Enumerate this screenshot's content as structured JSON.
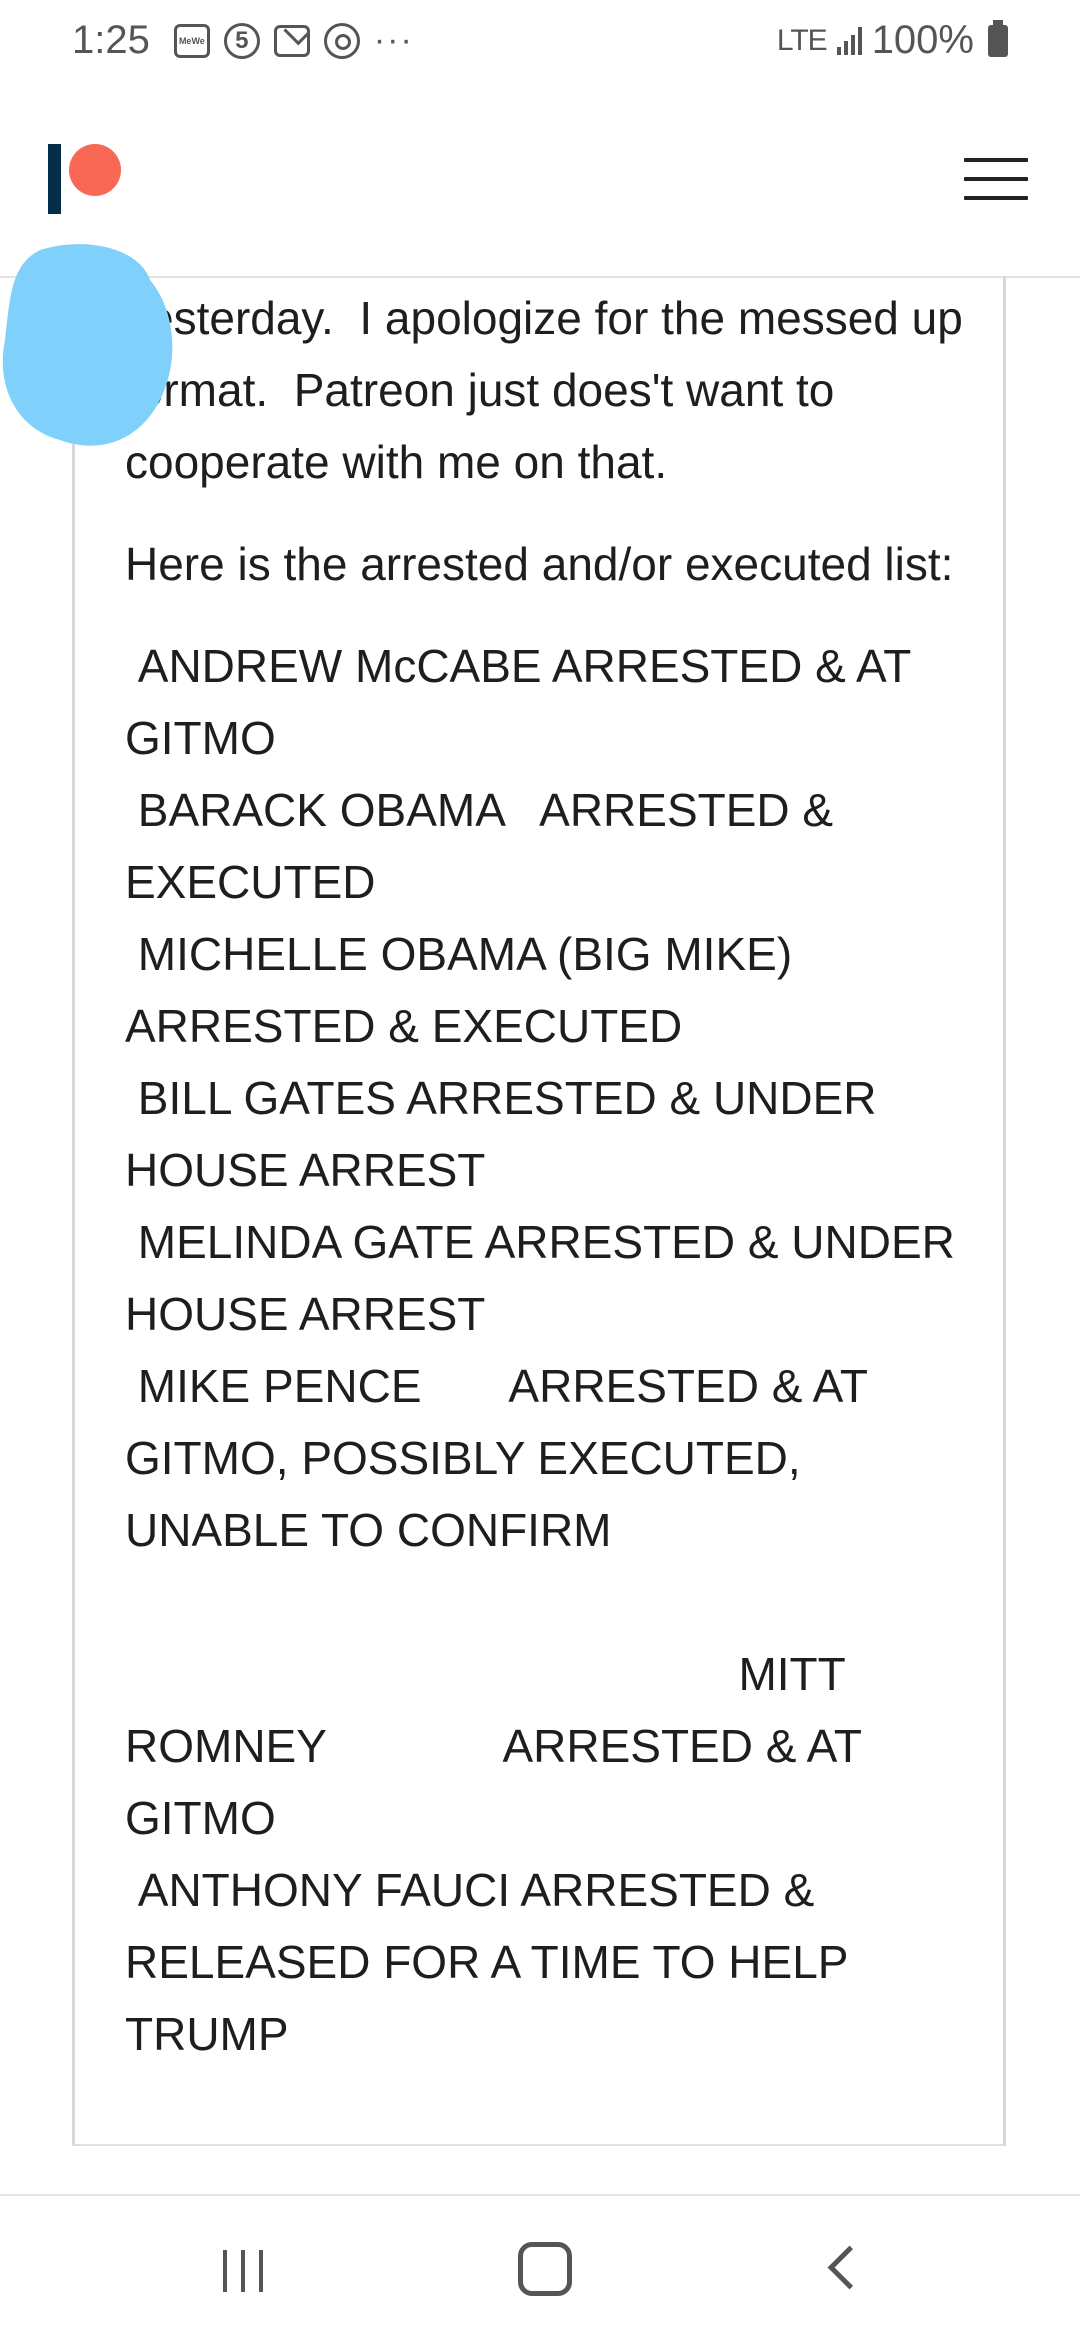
{
  "status_bar": {
    "time": "1:25",
    "notification_icons": [
      "mewe-icon",
      "five-icon",
      "mail-icon",
      "swirl-icon"
    ],
    "more_dots": "···",
    "network": "LTE",
    "battery": "100%"
  },
  "header": {
    "logo_colors": {
      "bar": "#052d49",
      "circle": "#f96854"
    }
  },
  "post": {
    "intro_text": "yesterday.  I apologize for the messed up format.  Patreon just does't want to cooperate with me on that.",
    "list_heading": "Here is the arrested and/or executed list:",
    "list_text": " ANDREW McCABE ARRESTED & AT GITMO\n BARACK OBAMA   ARRESTED & EXECUTED\n MICHELLE OBAMA (BIG MIKE) ARRESTED & EXECUTED\n BILL GATES ARRESTED & UNDER HOUSE ARREST\n MELINDA GATE ARRESTED & UNDER HOUSE ARREST\n MIKE PENCE       ARRESTED & AT GITMO, POSSIBLY EXECUTED, UNABLE TO CONFIRM\n\n                                                MITT ROMNEY              ARRESTED & AT GITMO\n ANTHONY FAUCI ARRESTED & RELEASED FOR A TIME TO HELP TRUMP"
  },
  "redaction_color": "#7fd0fb"
}
